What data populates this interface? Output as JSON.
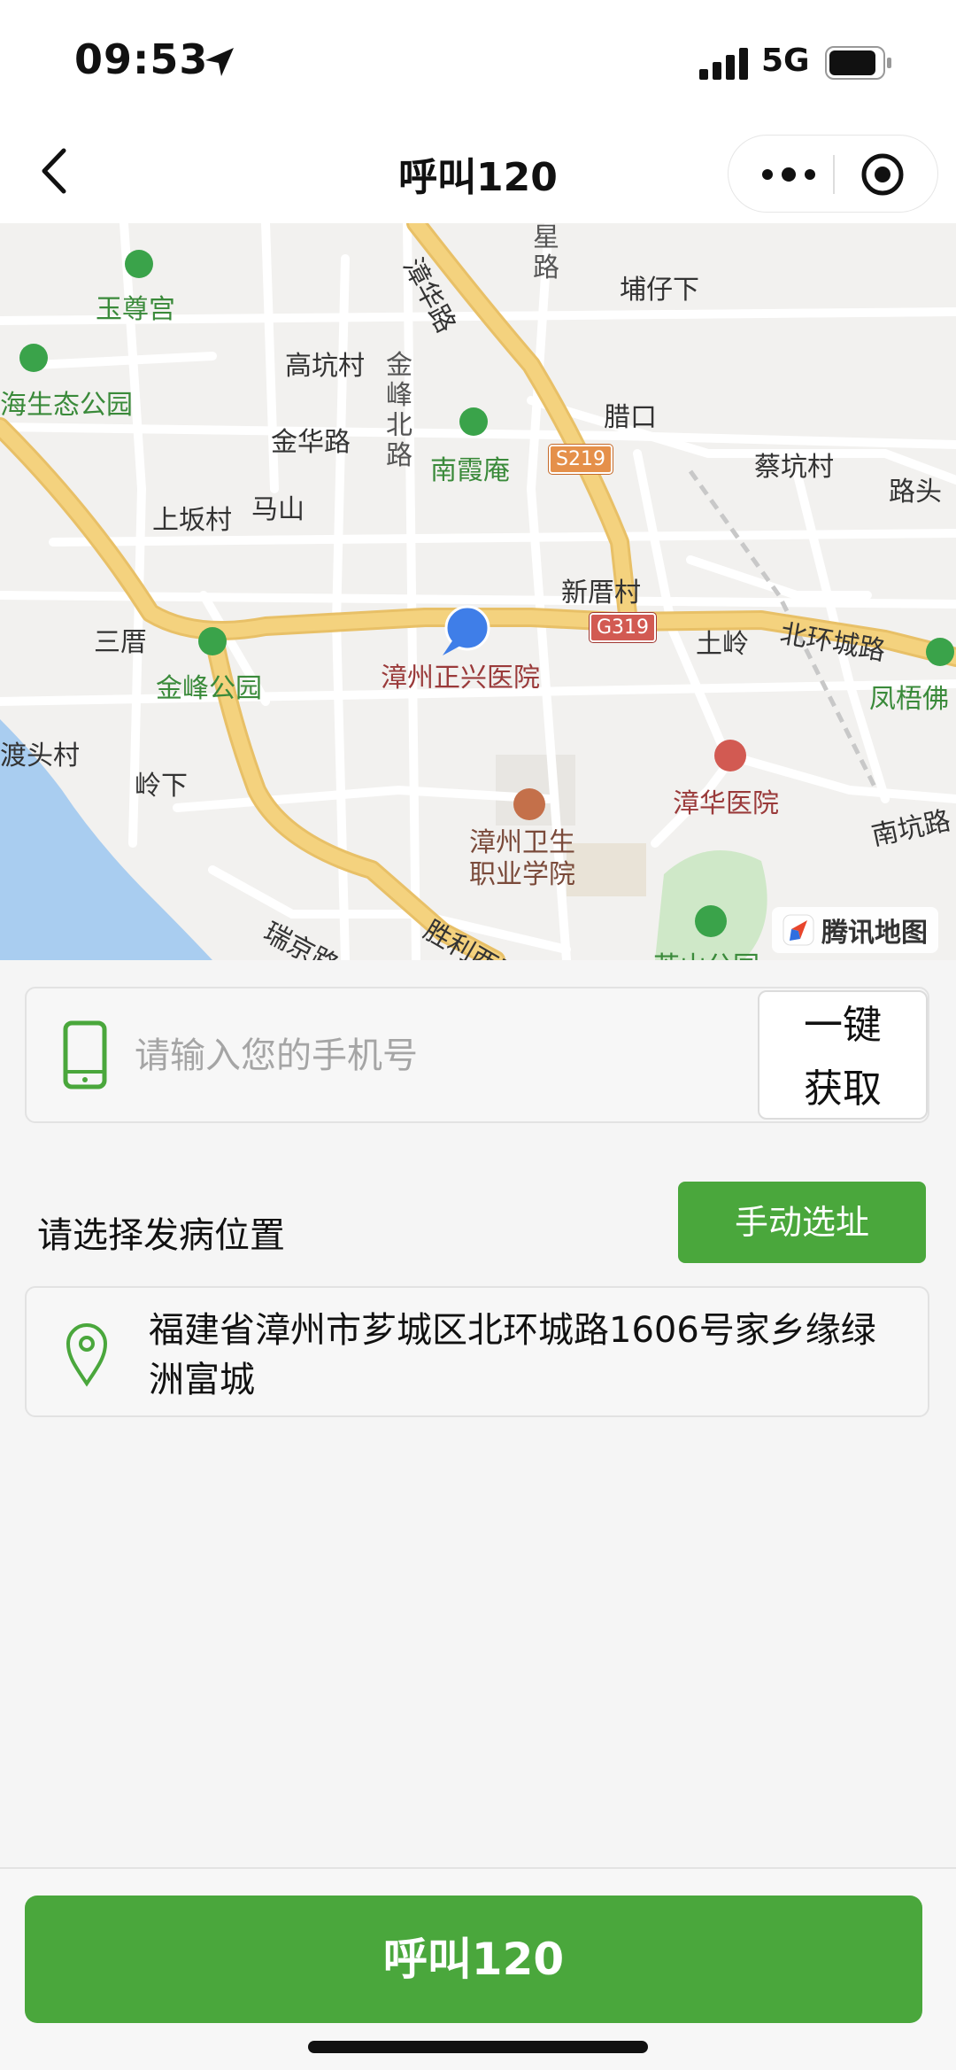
{
  "status_bar": {
    "time": "09:53",
    "network": "5G",
    "icons": [
      "location-arrow-icon",
      "signal-icon",
      "battery-icon"
    ]
  },
  "nav": {
    "title": "呼叫120",
    "icons": [
      "back-icon",
      "more-icon",
      "target-icon"
    ]
  },
  "map": {
    "provider": "腾讯地图",
    "labels": {
      "yuzungong": "玉尊宫",
      "eco_park": "海生态公园",
      "gaokeng": "高坑村",
      "jinfeng_north": "金峰北路",
      "jinhua_rd": "金华路",
      "nanxiaan": "南霞庵",
      "shangban": "上坂村",
      "mashan": "马山",
      "zhanghua_rd": "漳华路",
      "star_rd": "星路",
      "buzixia": "埔仔下",
      "lakou": "腊口",
      "caikeng": "蔡坑村",
      "lutou": "路头",
      "xincuo": "新厝村",
      "sancuo": "三厝",
      "jinfeng_park": "金峰公园",
      "zhengxing_hospital": "漳州正兴医院",
      "tuling": "土岭",
      "beihuan_rd": "北环城路",
      "fengwu": "凤梧佛",
      "dutou": "渡头村",
      "lingxia": "岭下",
      "zhanghua_hospital": "漳华医院",
      "health_college": "漳州卫生职业学院",
      "nankeng_rd": "南坑路",
      "ruijing_rd": "瑞京路",
      "shengli_rd": "胜利西路",
      "zhishan_park": "芝山公园"
    },
    "shields": {
      "s219": "S219",
      "g319": "G319"
    },
    "colors": {
      "road": "#f4d27e",
      "water": "#a9cdf0",
      "park": "#cfe8c8",
      "pin": "#3f7ee8"
    }
  },
  "phone": {
    "placeholder": "请输入您的手机号",
    "value": "",
    "get_label_line1": "一键",
    "get_label_line2": "获取"
  },
  "location": {
    "section_title": "请选择发病位置",
    "manual_label": "手动选址",
    "address": "福建省漳州市芗城区北环城路1606号家乡缘绿洲富城"
  },
  "footer": {
    "call_label": "呼叫120"
  },
  "theme": {
    "accent": "#4aa73c"
  }
}
